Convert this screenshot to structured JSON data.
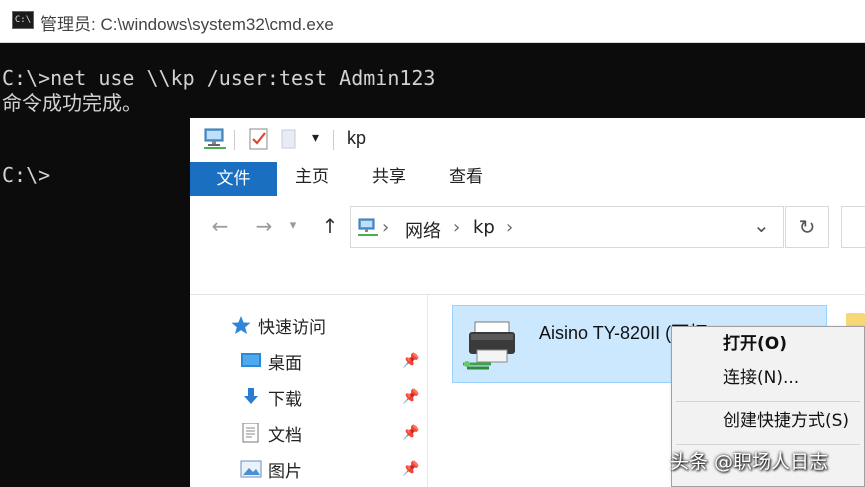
{
  "cmd": {
    "title": "管理员: C:\\windows\\system32\\cmd.exe",
    "icon": "cmd-icon",
    "line1": "C:\\>net use \\\\kp /user:test Admin123",
    "line2": "命令成功完成。",
    "prompt": "C:\\>"
  },
  "explorer": {
    "window_title": "kp",
    "qat": {
      "dropdown": "▾"
    },
    "ribbon": {
      "file_tab": "文件",
      "tabs": [
        "主页",
        "共享",
        "查看"
      ]
    },
    "nav": {
      "back": "←",
      "forward": "→",
      "history": "▾",
      "up": "↑"
    },
    "address": {
      "parts": [
        "网络",
        "kp"
      ],
      "sep": "›",
      "dropdown": "⌄",
      "refresh": "↻"
    },
    "nav_pane": {
      "items": [
        {
          "label": "快速访问",
          "icon": "star-icon"
        },
        {
          "label": "桌面",
          "icon": "desktop-icon",
          "pinned": true
        },
        {
          "label": "下载",
          "icon": "download-icon",
          "pinned": true
        },
        {
          "label": "文档",
          "icon": "document-icon",
          "pinned": true
        },
        {
          "label": "图片",
          "icon": "picture-icon",
          "pinned": true
        }
      ],
      "pin_glyph": "📌"
    },
    "content": {
      "printer_name": "Aisino TY-820II (可打..."
    }
  },
  "context_menu": {
    "items": [
      "打开(O)",
      "连接(N)...",
      "创建快捷方式(S)"
    ]
  },
  "watermark": "头条 @职场人日志",
  "colors": {
    "ribbon_file_tab": "#1a6fc1",
    "selection": "#cce8ff",
    "console_bg": "#0c0c0c",
    "console_text": "#d2d2d2"
  }
}
